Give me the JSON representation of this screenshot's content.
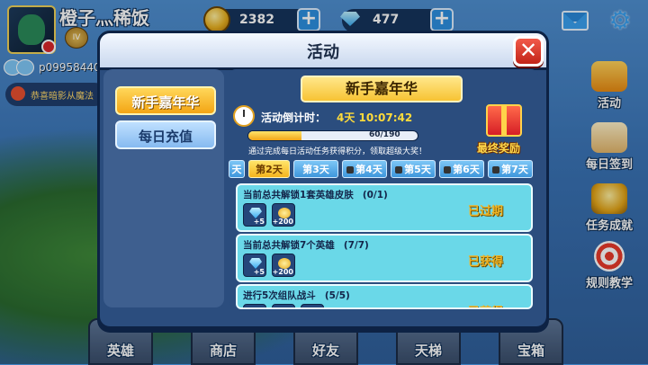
{
  "player": {
    "name": "橙子灬稀饭",
    "rank_badge": "IV",
    "chat_id": "p09958440",
    "announcement": "恭喜暗影从魔法"
  },
  "resources": {
    "gold": "2382",
    "gems": "477",
    "plus": "+"
  },
  "icons": {
    "mail": "mail-icon",
    "settings": "gear-icon",
    "close": "close-icon",
    "clock": "clock-icon",
    "gift": "gift-box-icon"
  },
  "sidebar": [
    {
      "label": "活动",
      "icon": "flag-icon"
    },
    {
      "label": "每日签到",
      "icon": "calendar-scroll-icon"
    },
    {
      "label": "任务成就",
      "icon": "trophy-icon"
    },
    {
      "label": "规则教学",
      "icon": "target-icon"
    }
  ],
  "bottom_nav": [
    {
      "label": "英雄"
    },
    {
      "label": "商店"
    },
    {
      "label": "好友"
    },
    {
      "label": "天梯"
    },
    {
      "label": "宝箱"
    }
  ],
  "modal": {
    "title": "活动",
    "close": "✕",
    "tabs": [
      {
        "label": "新手嘉年华",
        "active": true
      },
      {
        "label": "每日充值",
        "active": false
      }
    ],
    "banner": "新手嘉年华",
    "countdown_label": "活动倒计时：",
    "countdown_value": "4天 10:07:42",
    "progress": {
      "current": 60,
      "max": 190,
      "text": "60/190"
    },
    "hint": "通过完成每日活动任务获得积分，领取超级大奖！",
    "final_reward": "最终奖励",
    "days": [
      {
        "label": "天",
        "active": false,
        "locked": false
      },
      {
        "label": "第2天",
        "active": true,
        "locked": false
      },
      {
        "label": "第3天",
        "active": false,
        "locked": false
      },
      {
        "label": "第4天",
        "active": false,
        "locked": true
      },
      {
        "label": "第5天",
        "active": false,
        "locked": true
      },
      {
        "label": "第6天",
        "active": false,
        "locked": true
      },
      {
        "label": "第7天",
        "active": false,
        "locked": true
      }
    ],
    "tasks": [
      {
        "name": "当前总共解锁1套英雄皮肤",
        "progress": "(0/1)",
        "rewards": [
          "+5",
          "+200"
        ],
        "status": "已过期"
      },
      {
        "name": "当前总共解锁7个英雄",
        "progress": "(7/7)",
        "rewards": [
          "+5",
          "+200"
        ],
        "status": "已获得"
      },
      {
        "name": "进行5次组队战斗",
        "progress": "(5/5)",
        "rewards": [
          "",
          "",
          ""
        ],
        "status": "已获得"
      }
    ]
  },
  "colors": {
    "accent_gold": "#f3a514",
    "panel_blue": "#2b4d7e",
    "task_cyan": "#6ad8e8",
    "close_red": "#d8301e"
  }
}
